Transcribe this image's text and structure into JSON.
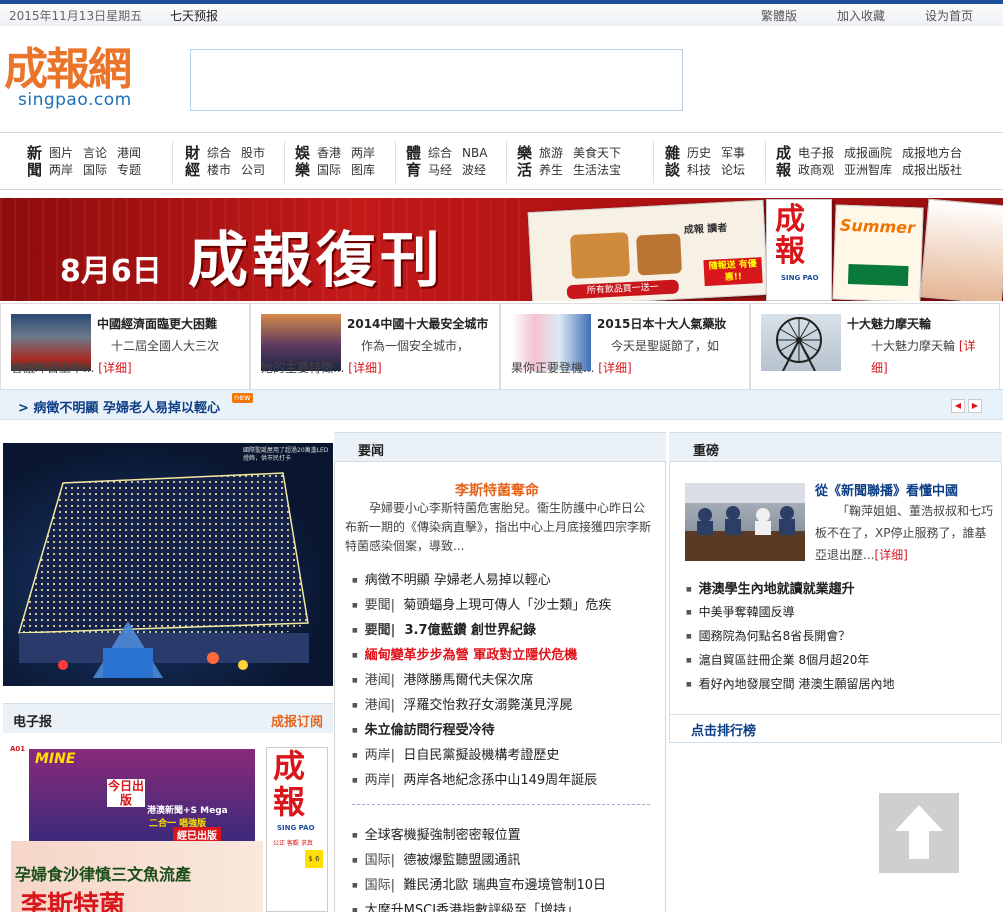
{
  "topbar": {
    "date": "2015年11月13日星期五",
    "forecast": "七天预报",
    "traditional": "繁體版",
    "bookmark": "加入收藏",
    "homepage": "设为首页"
  },
  "logo": {
    "cn": "成報網",
    "en": "singpao.com"
  },
  "nav": [
    {
      "big": [
        "新",
        "聞"
      ],
      "row1": [
        "图片",
        "言论",
        "港闻"
      ],
      "row2": [
        "两岸",
        "国际",
        "专题"
      ]
    },
    {
      "big": [
        "財",
        "經"
      ],
      "row1": [
        "综合",
        "股市"
      ],
      "row2": [
        "楼市",
        "公司"
      ]
    },
    {
      "big": [
        "娛",
        "樂"
      ],
      "row1": [
        "香港",
        "两岸"
      ],
      "row2": [
        "国际",
        "图库"
      ]
    },
    {
      "big": [
        "體",
        "育"
      ],
      "row1": [
        "综合",
        "NBA"
      ],
      "row2": [
        "马经",
        "波经"
      ]
    },
    {
      "big": [
        "樂",
        "活"
      ],
      "row1": [
        "旅游",
        "美食天下"
      ],
      "row2": [
        "养生",
        "生活法宝"
      ]
    },
    {
      "big": [
        "雜",
        "談"
      ],
      "row1": [
        "历史",
        "军事"
      ],
      "row2": [
        "科技",
        "论坛"
      ]
    },
    {
      "big": [
        "成",
        "報"
      ],
      "row1": [
        "电子报",
        "成报画院",
        "成报地方台"
      ],
      "row2": [
        "政商观",
        "亚洲智库",
        "成报出版社"
      ]
    }
  ],
  "banner": {
    "date": "8月6日",
    "title": "成報復刊",
    "paper_masthead": "成報",
    "paper_en": "SING PAO",
    "promo_text": "成報 讀者",
    "promo_badge": "隨報送 有優惠!!",
    "promo_combo": "所有飲品買一送一",
    "summer": "Summer"
  },
  "cards": [
    {
      "title": "中國經濟面臨更大困難",
      "desc1": "十二屆全國人大三次",
      "desc2": "會議昨日上午...",
      "more": "[详细]"
    },
    {
      "title": "2014中國十大最安全城市",
      "desc1": "作為一個安全城市，",
      "desc2": "她的主要特徵...",
      "more": "[详细]"
    },
    {
      "title": "2015日本十大人氣藥妝",
      "desc1": "今天是聖誕節了，如",
      "desc2": "果你正要登機...",
      "more": "[详细]"
    },
    {
      "title": "十大魅力摩天輪",
      "desc1": "十大魅力摩天輪",
      "desc2": "",
      "more": "[详细]"
    }
  ],
  "ticker": {
    "text": "> 病徵不明顯 孕婦老人易掉以輕心",
    "badge": "new",
    "prev": "◀",
    "next": "▶"
  },
  "left": {
    "photo_caption": "國際聖誕屋用了超過20萬盞LED燈飾，供市民打卡",
    "epaper_label": "电子报",
    "subscribe_label": "成报订阅",
    "epaper_masthead": "成報",
    "epaper_en": "SING PAO",
    "epaper_motto": "公正 客觀 求真",
    "epaper_price": "$ 6",
    "epaper_headline": "孕婦食沙律慎三文魚流產",
    "epaper_bottom": "李斯特菌",
    "mag_title": "MINE",
    "mag_cover": "今日出版",
    "mag_sub": "港澳新聞+S Mega",
    "mag_combo": "二合一 唱強版",
    "mag_ready": "經已出版",
    "epaper_tag": "A01"
  },
  "middle": {
    "header": "要闻",
    "headline": "李斯特菌奪命",
    "lead": "孕婦要小心李斯特菌危害胎兒。衞生防護中心昨日公布新一期的《傳染病直擊》，指出中心上月底接獲四宗李斯特菌感染個案，導致...",
    "list1": [
      {
        "tag": "",
        "text": "病徵不明顯 孕婦老人易掉以輕心",
        "style": ""
      },
      {
        "tag": "要聞|",
        "text": "菊頭蝠身上現可傳人「沙士類」危疾",
        "style": ""
      },
      {
        "tag": "要聞|",
        "text": "3.7億藍鑽 創世界紀錄",
        "style": "bold"
      },
      {
        "tag": "",
        "text": "緬甸變革步步為營 軍政對立隱伏危機",
        "style": "red"
      },
      {
        "tag": "港闻|",
        "text": "港隊勝馬爾代夫保次席",
        "style": ""
      },
      {
        "tag": "港闻|",
        "text": "浮羅交怡救孖女溺斃漢見浮屍",
        "style": ""
      },
      {
        "tag": "",
        "text": "朱立倫訪問行程受冷待",
        "style": "bold"
      },
      {
        "tag": "两岸|",
        "text": "日自民黨擬設機構考證歷史",
        "style": ""
      },
      {
        "tag": "两岸|",
        "text": "两岸各地紀念孫中山149周年誕辰",
        "style": ""
      }
    ],
    "list2": [
      {
        "tag": "",
        "text": "全球客機擬強制密密報位置",
        "style": ""
      },
      {
        "tag": "国际|",
        "text": "德被爆監聽盟國通訊",
        "style": ""
      },
      {
        "tag": "国际|",
        "text": "難民湧北歐 瑞典宣布邊境管制10日",
        "style": ""
      },
      {
        "tag": "",
        "text": "大摩升MSCI香港指數評級至「增持」",
        "style": ""
      }
    ]
  },
  "right": {
    "header": "重磅",
    "title": "從《新聞聯播》看懂中國",
    "desc": "「鞠萍姐姐、董浩叔叔和七巧板不在了，XP停止服務了，誰基亞退出歷...",
    "more": "[详细]",
    "list": [
      {
        "text": "港澳學生內地就讀就業趨升",
        "style": "bold"
      },
      {
        "text": "中美爭奪韓國反導",
        "style": ""
      },
      {
        "text": "國務院為何點名8省長開會？",
        "style": ""
      },
      {
        "text": "滬自貿區註冊企業 8個月超20年",
        "style": ""
      },
      {
        "text": "看好內地發展空間 港澳生願留居內地",
        "style": ""
      }
    ],
    "rank_label": "点击排行榜"
  },
  "totop_icon": "arrow-up-icon"
}
